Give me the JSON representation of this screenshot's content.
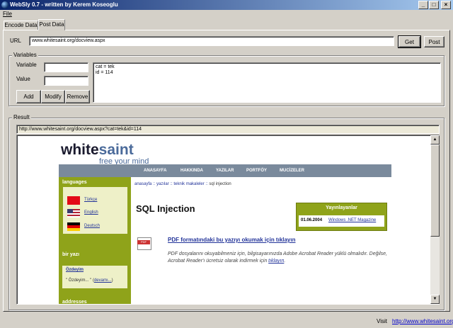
{
  "window": {
    "title": "WebSly 0.7 - written by Kerem Koseoglu",
    "min": "_",
    "max": "□",
    "close": "×"
  },
  "menu": {
    "file": "File"
  },
  "tabs": [
    "Encode Data",
    "Post Data"
  ],
  "url": {
    "label": "URL",
    "value": "www.whitesaint.org/docview.aspx",
    "get": "Get",
    "post": "Post"
  },
  "variables": {
    "group": "Variables",
    "variable_label": "Variable",
    "value_label": "Value",
    "variable_value": "",
    "value_value": "",
    "list": [
      "cat = tek",
      "id = 114"
    ],
    "add": "Add",
    "modify": "Modify",
    "remove": "Remove"
  },
  "result": {
    "group": "Result",
    "address": "http://www.whitesaint.org/docview.aspx?cat=tek&id=114"
  },
  "page": {
    "logo_white": "white",
    "logo_saint": "saint",
    "tagline": "free your mind",
    "nav": [
      "ANASAYFA",
      "HAKKINDA",
      "YAZILAR",
      "PORTFÖY",
      "MUCİZELER"
    ],
    "languages_heading": "languages",
    "languages": [
      "Türkçe",
      "English",
      "Deutsch"
    ],
    "bir_yazi_heading": "bir yazı",
    "yazi_title": "Özdeyim",
    "yazi_excerpt": "\" Özdeyim... \"",
    "yazi_more": "devamı...",
    "addresses_heading": "addresses",
    "breadcrumb": [
      "anasayfa",
      "yazılar",
      "teknik makaleler",
      "sql injection"
    ],
    "breadcrumb_sep": " :: ",
    "heading": "SQL Injection",
    "published_heading": "Yayınlayanlar",
    "published_date": "01.06.2004",
    "published_by": "Windows .NET Magazine",
    "pdf_icon": "PDF",
    "pdf_link": "PDF formatındaki bu yazıyı okumak için tıklayın",
    "pdf_note_1": "PDF dosyalarını okuyabilmeniz için, bilgisayarınızda Adobe Acrobat Reader yüklü olmalıdır. Değilse, Acrobat Reader'ı ücretsiz olarak indirmek için ",
    "pdf_note_link": "tıklayın",
    "pdf_note_end": "."
  },
  "status": {
    "visit_label": "Visit",
    "visit_link": "http://www.whitesaint.org"
  },
  "icons": {
    "app": "globe-icon",
    "scroll_up": "arrow-up-icon",
    "scroll_down": "arrow-down-icon"
  },
  "colors": {
    "title_bar": "#0a246a",
    "nav_bar": "#7a8a9c",
    "sidebar": "#8fa31a",
    "link": "#223399"
  }
}
